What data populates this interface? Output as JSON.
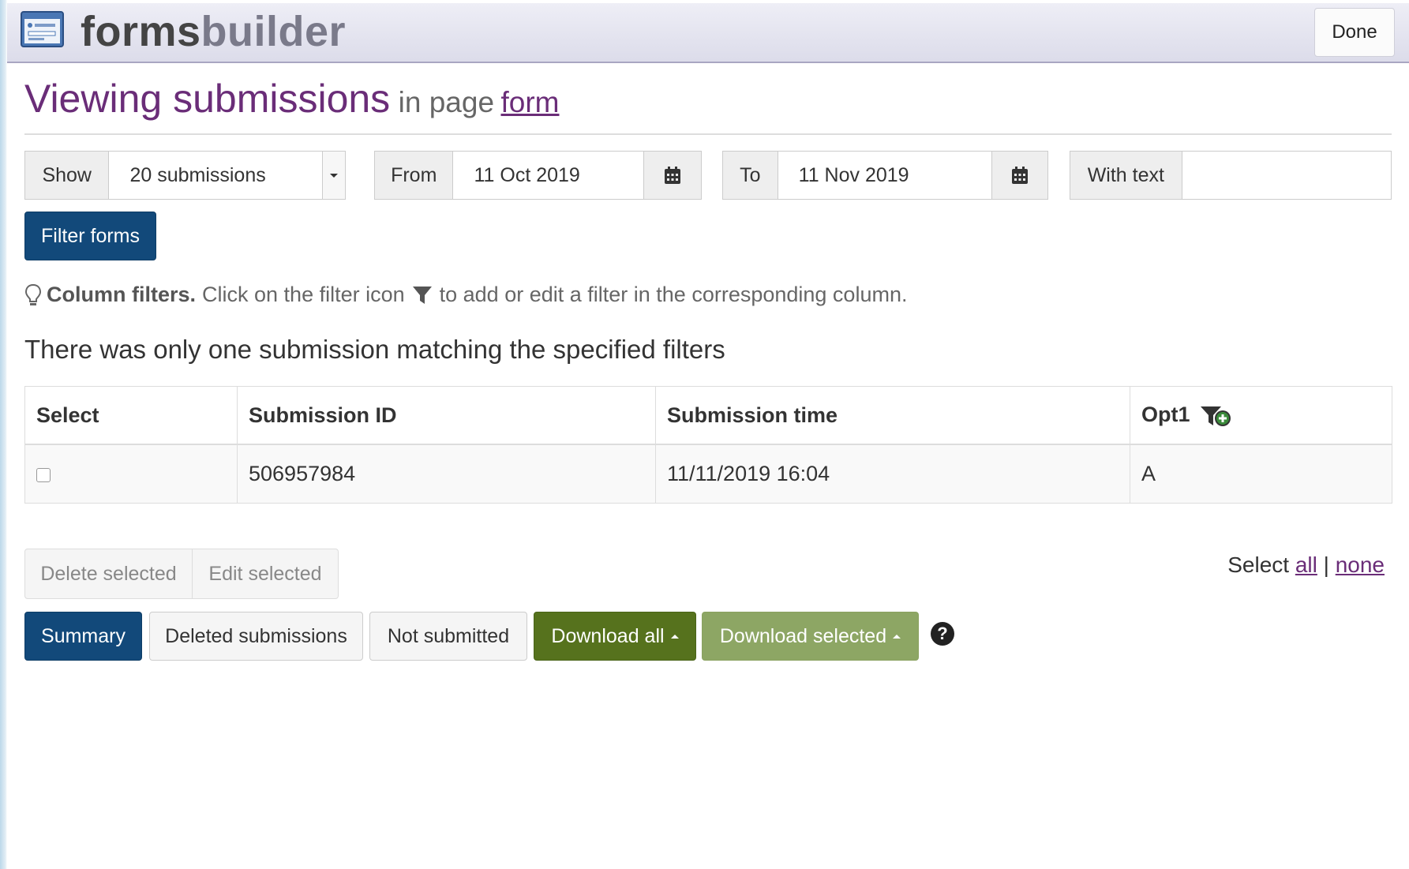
{
  "app": {
    "brand_part1": "forms",
    "brand_part2": "builder",
    "done_label": "Done"
  },
  "page": {
    "title": "Viewing submissions",
    "subtitle": "in page",
    "page_link": "form"
  },
  "filters": {
    "show_label": "Show",
    "show_value": "20 submissions",
    "from_label": "From",
    "from_value": "11 Oct 2019",
    "to_label": "To",
    "to_value": "11 Nov 2019",
    "text_label": "With text",
    "text_value": "",
    "filter_button": "Filter forms"
  },
  "hint": {
    "bold": "Column filters.",
    "before_icon": "Click on the filter icon",
    "after_icon": "to add or edit a filter in the corresponding column."
  },
  "result_text": "There was only one submission matching the specified filters",
  "table": {
    "columns": [
      "Select",
      "Submission ID",
      "Submission time",
      "Opt1"
    ],
    "rows": [
      {
        "checked": false,
        "id": "506957984",
        "time": "11/11/2019 16:04",
        "opt1": "A"
      }
    ]
  },
  "actions": {
    "delete_selected": "Delete selected",
    "edit_selected": "Edit selected",
    "select_prefix": "Select",
    "select_all": "all",
    "select_sep": "|",
    "select_none": "none",
    "summary": "Summary",
    "deleted_submissions": "Deleted submissions",
    "not_submitted": "Not submitted",
    "download_all": "Download all",
    "download_selected": "Download selected",
    "help_icon": "?"
  },
  "colors": {
    "accent_purple": "#6a2d78",
    "primary_blue": "#12497a",
    "success_green": "#56721d",
    "success_green_light": "#8da664"
  }
}
